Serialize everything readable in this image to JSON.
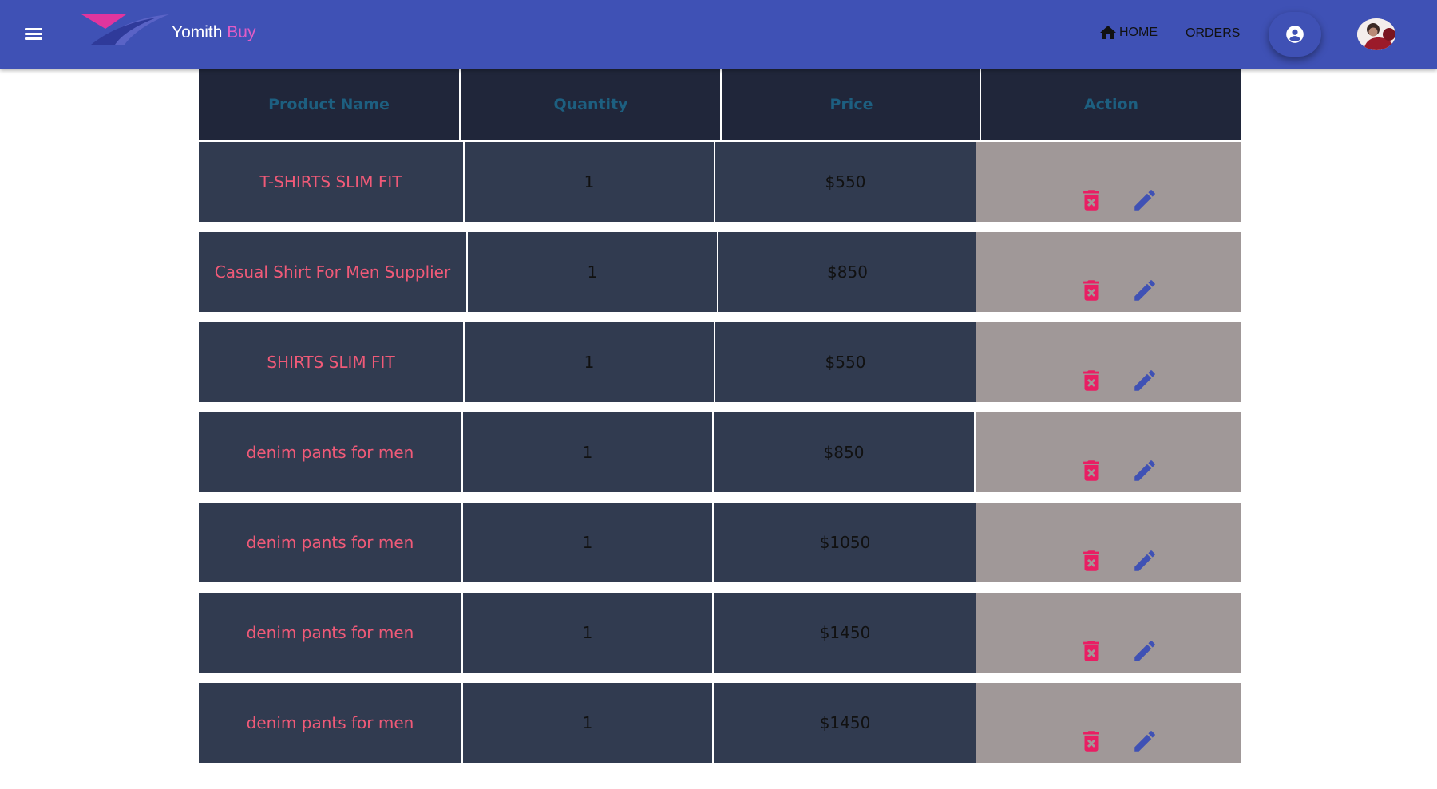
{
  "header": {
    "brand_main": "Yomith",
    "brand_accent": "Buy",
    "nav_home": "HOME",
    "nav_orders": "ORDERS",
    "menu_icon": "hamburger-menu-icon",
    "account_icon": "account-circle-icon"
  },
  "table": {
    "columns": [
      "Product Name",
      "Quantity",
      "Price",
      "Action"
    ],
    "rows": [
      {
        "name": "T-SHIRTS SLIM FIT",
        "quantity": "1",
        "price": "$550"
      },
      {
        "name": "Casual Shirt For Men Supplier",
        "quantity": "1",
        "price": "$850"
      },
      {
        "name": "SHIRTS SLIM FIT",
        "quantity": "1",
        "price": "$550"
      },
      {
        "name": "denim pants for men",
        "quantity": "1",
        "price": "$850"
      },
      {
        "name": "denim pants for men",
        "quantity": "1",
        "price": "$1050"
      },
      {
        "name": "denim pants for men",
        "quantity": "1",
        "price": "$1450"
      },
      {
        "name": "denim pants for men",
        "quantity": "1",
        "price": "$1450"
      }
    ],
    "row_icons": {
      "delete": "delete-forever-icon",
      "edit": "pencil-edit-icon"
    }
  },
  "colors": {
    "appbar": "#3f51b5",
    "brand_accent": "#e05dc6",
    "header_bg": "#20263a",
    "header_text": "#1d5f80",
    "cell_bg": "#313b50",
    "product_name": "#f05a78",
    "action_bg": "#a09898",
    "delete_icon": "#e91e63",
    "edit_icon": "#3f51b5"
  }
}
